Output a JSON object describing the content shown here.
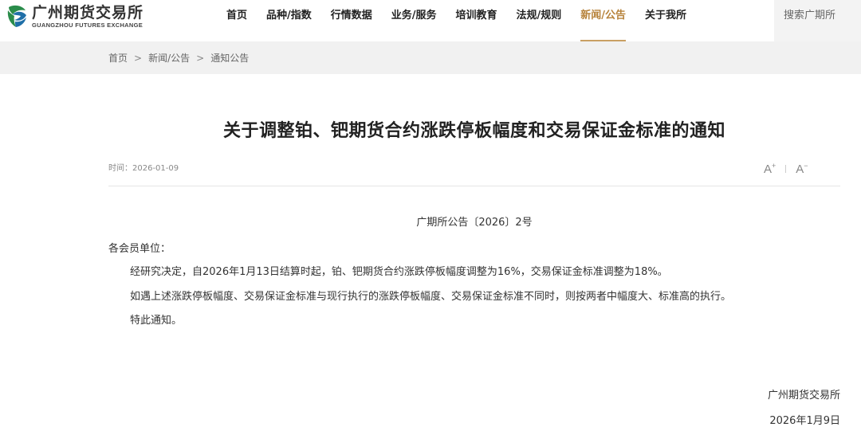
{
  "logo": {
    "cn": "广州期货交易所",
    "en": "GUANGZHOU FUTURES EXCHANGE",
    "icon": "gfex-logo-icon"
  },
  "nav": {
    "items": [
      {
        "label": "首页"
      },
      {
        "label": "品种/指数"
      },
      {
        "label": "行情数据"
      },
      {
        "label": "业务/服务"
      },
      {
        "label": "培训教育"
      },
      {
        "label": "法规/规则"
      },
      {
        "label": "新闻/公告",
        "active": true
      },
      {
        "label": "关于我所"
      }
    ],
    "active_color": "#b7833b"
  },
  "search": {
    "label": "搜索广期所"
  },
  "breadcrumb": [
    "首页",
    "新闻/公告",
    "通知公告"
  ],
  "breadcrumb_sep": ">",
  "article": {
    "title": "关于调整铂、钯期货合约涨跌停板幅度和交易保证金标准的通知",
    "time": "时间：2026-01-09",
    "font_increase": "A",
    "font_decrease": "A",
    "notice_no": "广期所公告〔2026〕2号",
    "salutation": "各会员单位：",
    "paragraphs": [
      "经研究决定，自2026年1月13日结算时起，铂、钯期货合约涨跌停板幅度调整为16%，交易保证金标准调整为18%。",
      "如遇上述涨跌停板幅度、交易保证金标准与现行执行的涨跌停板幅度、交易保证金标准不同时，则按两者中幅度大、标准高的执行。",
      "特此通知。"
    ],
    "signature_org": "广州期货交易所",
    "signature_date": "2026年1月9日"
  }
}
